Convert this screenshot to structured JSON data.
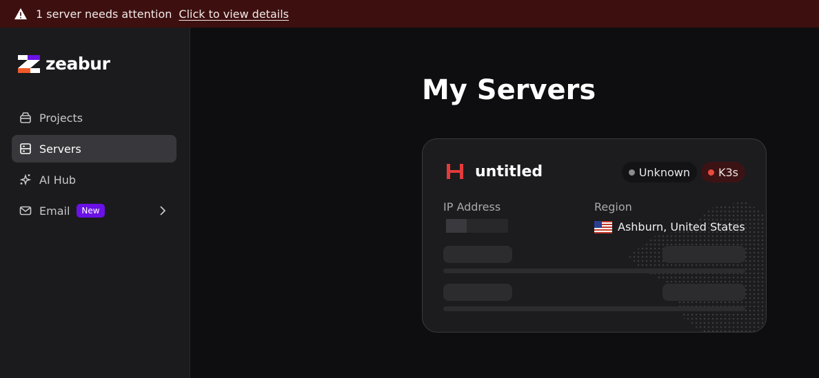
{
  "banner": {
    "message": "1 server needs attention",
    "link": "Click to view details"
  },
  "brand": {
    "name": "zeabur",
    "accent": "#6a11e6",
    "orange": "#f05a28"
  },
  "sidebar": {
    "items": [
      {
        "label": "Projects",
        "icon": "cube-icon"
      },
      {
        "label": "Servers",
        "icon": "server-icon",
        "active": true
      },
      {
        "label": "AI Hub",
        "icon": "sparkles-icon"
      },
      {
        "label": "Email",
        "icon": "mail-icon",
        "badge": "New"
      }
    ]
  },
  "main": {
    "title": "My Servers"
  },
  "server": {
    "name": "untitled",
    "status": "Unknown",
    "type": "K3s",
    "ip_label": "IP Address",
    "region_label": "Region",
    "region": "Ashburn, United States",
    "colors": {
      "status": "#8a8a8e",
      "type": "#ea4a3e",
      "icon": "#e33b3b"
    }
  }
}
